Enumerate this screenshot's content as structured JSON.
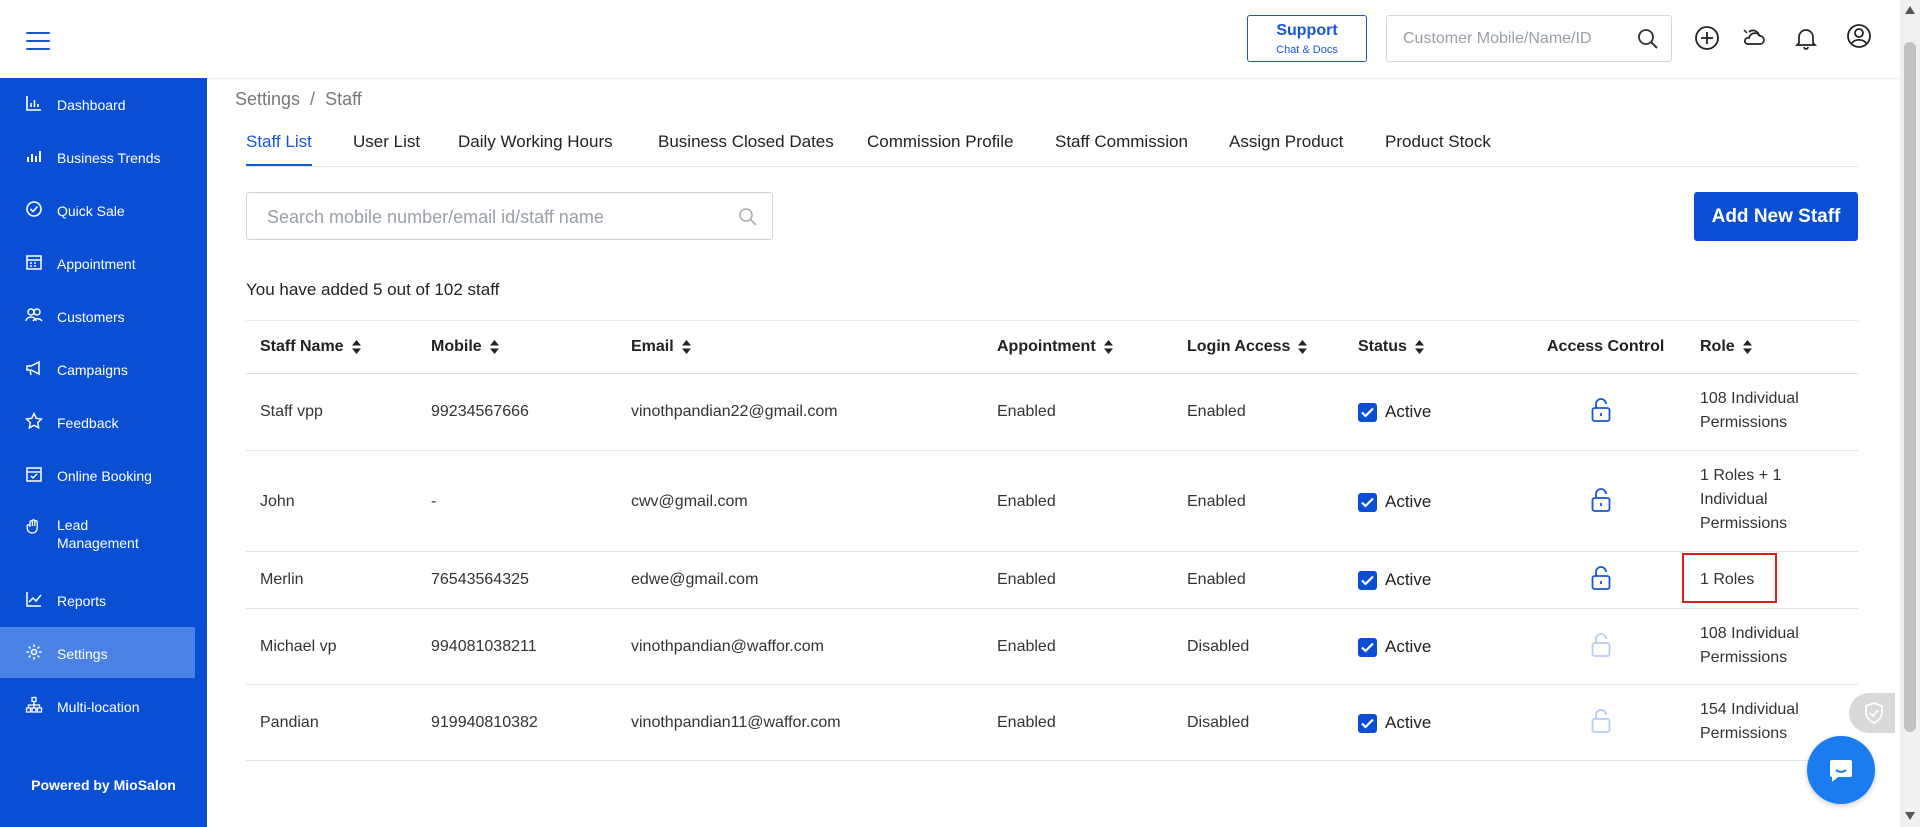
{
  "header": {
    "support": {
      "line1": "Support",
      "line2": "Chat & Docs"
    },
    "search_placeholder": "Customer Mobile/Name/ID",
    "icons": [
      "menu-icon",
      "search-icon",
      "add-circle-icon",
      "weather-icon",
      "bell-icon",
      "user-circle-icon"
    ]
  },
  "sidebar": {
    "items": [
      {
        "label": "Dashboard",
        "icon": "bar-chart-icon"
      },
      {
        "label": "Business Trends",
        "icon": "trend-bars-icon"
      },
      {
        "label": "Quick Sale",
        "icon": "check-circle-icon"
      },
      {
        "label": "Appointment",
        "icon": "calendar-icon"
      },
      {
        "label": "Customers",
        "icon": "users-icon"
      },
      {
        "label": "Campaigns",
        "icon": "megaphone-icon"
      },
      {
        "label": "Feedback",
        "icon": "star-icon"
      },
      {
        "label": "Online Booking",
        "icon": "calendar-check-icon"
      },
      {
        "label": "Lead",
        "label2": "Management",
        "icon": "hand-icon"
      },
      {
        "label": "Reports",
        "icon": "line-chart-icon"
      },
      {
        "label": "Settings",
        "icon": "gear-icon",
        "active": true
      },
      {
        "label": "Multi-location",
        "icon": "sitemap-icon"
      }
    ],
    "footer": "Powered by MioSalon"
  },
  "breadcrumb": {
    "parent": "Settings",
    "separator": "/",
    "current": "Staff"
  },
  "tabs": [
    {
      "label": "Staff List",
      "active": true
    },
    {
      "label": "User List"
    },
    {
      "label": "Daily Working Hours"
    },
    {
      "label": "Business Closed Dates"
    },
    {
      "label": "Commission Profile"
    },
    {
      "label": "Staff Commission"
    },
    {
      "label": "Assign Product"
    },
    {
      "label": "Product Stock"
    }
  ],
  "staff_search_placeholder": "Search mobile number/email id/staff name",
  "add_button": "Add New Staff",
  "count_text": "You have added 5 out of 102 staff",
  "table": {
    "headers": {
      "name": "Staff Name",
      "mobile": "Mobile",
      "email": "Email",
      "appointment": "Appointment",
      "login": "Login Access",
      "status": "Status",
      "access": "Access Control",
      "role": "Role"
    },
    "rows": [
      {
        "name": "Staff vpp",
        "mobile": "99234567666",
        "email": "vinothpandian22@gmail.com",
        "appointment": "Enabled",
        "login": "Enabled",
        "status": "Active",
        "checked": true,
        "lock_active": true,
        "role": "108 Individual Permissions"
      },
      {
        "name": "John",
        "mobile": "-",
        "email": "cwv@gmail.com",
        "appointment": "Enabled",
        "login": "Enabled",
        "status": "Active",
        "checked": true,
        "lock_active": true,
        "role": "1 Roles + 1 Individual Permissions"
      },
      {
        "name": "Merlin",
        "mobile": "76543564325",
        "email": "edwe@gmail.com",
        "appointment": "Enabled",
        "login": "Enabled",
        "status": "Active",
        "checked": true,
        "lock_active": true,
        "role": "1 Roles"
      },
      {
        "name": "Michael vp",
        "mobile": "994081038211",
        "email": "vinothpandian@waffor.com",
        "appointment": "Enabled",
        "login": "Disabled",
        "status": "Active",
        "checked": true,
        "lock_active": false,
        "role": "108 Individual Permissions"
      },
      {
        "name": "Pandian",
        "mobile": "919940810382",
        "email": "vinothpandian11@waffor.com",
        "appointment": "Enabled",
        "login": "Disabled",
        "status": "Active",
        "checked": true,
        "lock_active": false,
        "role": "154 Individual Permissions"
      }
    ]
  },
  "colors": {
    "brand": "#0a4fd3",
    "sidebar_active": "#4b82e6",
    "highlight": "#e01b22",
    "lock_disabled": "#b8cdf3"
  }
}
